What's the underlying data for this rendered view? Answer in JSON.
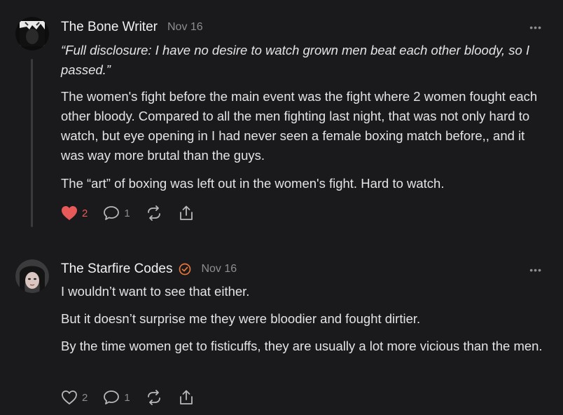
{
  "comments": [
    {
      "author": "The Bone Writer",
      "date": "Nov 16",
      "more_label": "•••",
      "quote": "“Full disclosure: I have no desire to watch grown men beat each other bloody, so I passed.”",
      "paragraphs": [
        "The women's fight before the main event was the fight where 2 women fought each other bloody. Compared to all the men fighting last night, that was not only hard to watch, but eye opening in I had never seen a female boxing match before,, and it was way more brutal than the guys.",
        "The “art” of boxing was left out in the women's fight. Hard to watch."
      ],
      "likes": "2",
      "liked": true,
      "replies": "1",
      "like_color": "#e85a5a"
    },
    {
      "author": "The Starfire Codes",
      "date": "Nov 16",
      "verified": true,
      "more_label": "•••",
      "paragraphs": [
        "I wouldn’t want to see that either.",
        "But it doesn’t surprise me they were bloodier and fought dirtier.",
        "By the time women get to fisticuffs, they are usually a lot more vicious than the men."
      ],
      "likes": "2",
      "liked": false,
      "replies": "1",
      "verified_color": "#e8743b"
    }
  ]
}
